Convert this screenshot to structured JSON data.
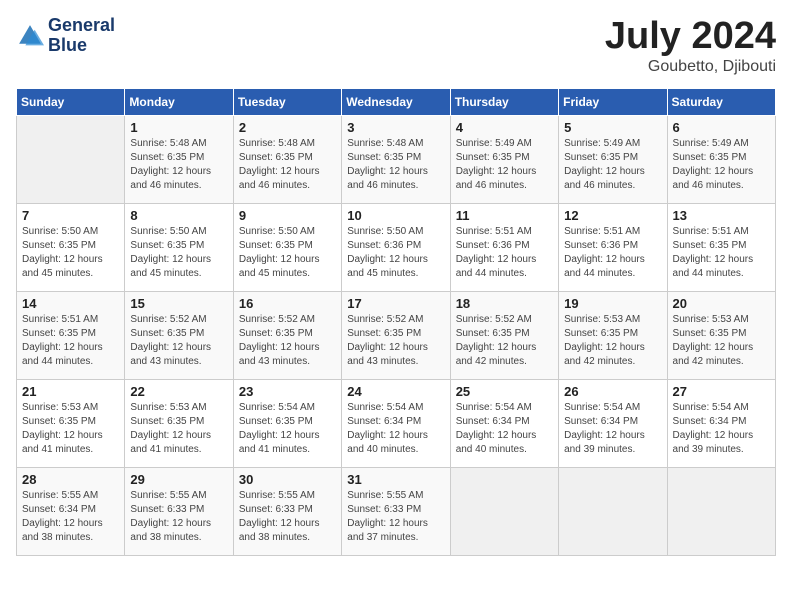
{
  "header": {
    "logo_line1": "General",
    "logo_line2": "Blue",
    "month": "July 2024",
    "location": "Goubetto, Djibouti"
  },
  "weekdays": [
    "Sunday",
    "Monday",
    "Tuesday",
    "Wednesday",
    "Thursday",
    "Friday",
    "Saturday"
  ],
  "weeks": [
    [
      {
        "day": "",
        "info": ""
      },
      {
        "day": "1",
        "info": "Sunrise: 5:48 AM\nSunset: 6:35 PM\nDaylight: 12 hours\nand 46 minutes."
      },
      {
        "day": "2",
        "info": "Sunrise: 5:48 AM\nSunset: 6:35 PM\nDaylight: 12 hours\nand 46 minutes."
      },
      {
        "day": "3",
        "info": "Sunrise: 5:48 AM\nSunset: 6:35 PM\nDaylight: 12 hours\nand 46 minutes."
      },
      {
        "day": "4",
        "info": "Sunrise: 5:49 AM\nSunset: 6:35 PM\nDaylight: 12 hours\nand 46 minutes."
      },
      {
        "day": "5",
        "info": "Sunrise: 5:49 AM\nSunset: 6:35 PM\nDaylight: 12 hours\nand 46 minutes."
      },
      {
        "day": "6",
        "info": "Sunrise: 5:49 AM\nSunset: 6:35 PM\nDaylight: 12 hours\nand 46 minutes."
      }
    ],
    [
      {
        "day": "7",
        "info": "Sunrise: 5:50 AM\nSunset: 6:35 PM\nDaylight: 12 hours\nand 45 minutes."
      },
      {
        "day": "8",
        "info": "Sunrise: 5:50 AM\nSunset: 6:35 PM\nDaylight: 12 hours\nand 45 minutes."
      },
      {
        "day": "9",
        "info": "Sunrise: 5:50 AM\nSunset: 6:35 PM\nDaylight: 12 hours\nand 45 minutes."
      },
      {
        "day": "10",
        "info": "Sunrise: 5:50 AM\nSunset: 6:36 PM\nDaylight: 12 hours\nand 45 minutes."
      },
      {
        "day": "11",
        "info": "Sunrise: 5:51 AM\nSunset: 6:36 PM\nDaylight: 12 hours\nand 44 minutes."
      },
      {
        "day": "12",
        "info": "Sunrise: 5:51 AM\nSunset: 6:36 PM\nDaylight: 12 hours\nand 44 minutes."
      },
      {
        "day": "13",
        "info": "Sunrise: 5:51 AM\nSunset: 6:35 PM\nDaylight: 12 hours\nand 44 minutes."
      }
    ],
    [
      {
        "day": "14",
        "info": "Sunrise: 5:51 AM\nSunset: 6:35 PM\nDaylight: 12 hours\nand 44 minutes."
      },
      {
        "day": "15",
        "info": "Sunrise: 5:52 AM\nSunset: 6:35 PM\nDaylight: 12 hours\nand 43 minutes."
      },
      {
        "day": "16",
        "info": "Sunrise: 5:52 AM\nSunset: 6:35 PM\nDaylight: 12 hours\nand 43 minutes."
      },
      {
        "day": "17",
        "info": "Sunrise: 5:52 AM\nSunset: 6:35 PM\nDaylight: 12 hours\nand 43 minutes."
      },
      {
        "day": "18",
        "info": "Sunrise: 5:52 AM\nSunset: 6:35 PM\nDaylight: 12 hours\nand 42 minutes."
      },
      {
        "day": "19",
        "info": "Sunrise: 5:53 AM\nSunset: 6:35 PM\nDaylight: 12 hours\nand 42 minutes."
      },
      {
        "day": "20",
        "info": "Sunrise: 5:53 AM\nSunset: 6:35 PM\nDaylight: 12 hours\nand 42 minutes."
      }
    ],
    [
      {
        "day": "21",
        "info": "Sunrise: 5:53 AM\nSunset: 6:35 PM\nDaylight: 12 hours\nand 41 minutes."
      },
      {
        "day": "22",
        "info": "Sunrise: 5:53 AM\nSunset: 6:35 PM\nDaylight: 12 hours\nand 41 minutes."
      },
      {
        "day": "23",
        "info": "Sunrise: 5:54 AM\nSunset: 6:35 PM\nDaylight: 12 hours\nand 41 minutes."
      },
      {
        "day": "24",
        "info": "Sunrise: 5:54 AM\nSunset: 6:34 PM\nDaylight: 12 hours\nand 40 minutes."
      },
      {
        "day": "25",
        "info": "Sunrise: 5:54 AM\nSunset: 6:34 PM\nDaylight: 12 hours\nand 40 minutes."
      },
      {
        "day": "26",
        "info": "Sunrise: 5:54 AM\nSunset: 6:34 PM\nDaylight: 12 hours\nand 39 minutes."
      },
      {
        "day": "27",
        "info": "Sunrise: 5:54 AM\nSunset: 6:34 PM\nDaylight: 12 hours\nand 39 minutes."
      }
    ],
    [
      {
        "day": "28",
        "info": "Sunrise: 5:55 AM\nSunset: 6:34 PM\nDaylight: 12 hours\nand 38 minutes."
      },
      {
        "day": "29",
        "info": "Sunrise: 5:55 AM\nSunset: 6:33 PM\nDaylight: 12 hours\nand 38 minutes."
      },
      {
        "day": "30",
        "info": "Sunrise: 5:55 AM\nSunset: 6:33 PM\nDaylight: 12 hours\nand 38 minutes."
      },
      {
        "day": "31",
        "info": "Sunrise: 5:55 AM\nSunset: 6:33 PM\nDaylight: 12 hours\nand 37 minutes."
      },
      {
        "day": "",
        "info": ""
      },
      {
        "day": "",
        "info": ""
      },
      {
        "day": "",
        "info": ""
      }
    ]
  ]
}
